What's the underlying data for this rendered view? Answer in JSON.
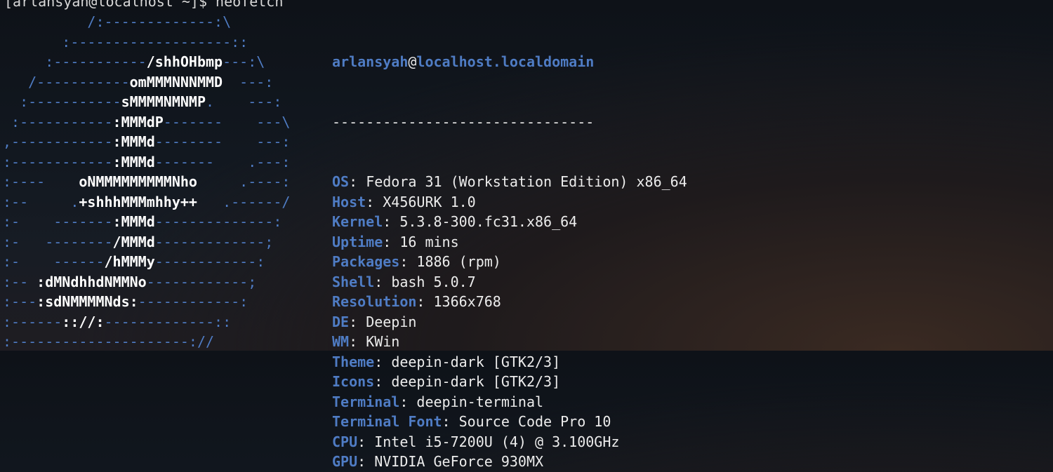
{
  "prompt": "[arlansyah@localhost ~]$ neofetch",
  "art": [
    [
      [
        "b",
        "          /:-------------:\\"
      ]
    ],
    [
      [
        "b",
        "       :-------------------::"
      ]
    ],
    [
      [
        "b",
        "     :-----------"
      ],
      [
        "w",
        "/shhOHbmp"
      ],
      [
        "b",
        "---:\\"
      ]
    ],
    [
      [
        "b",
        "   /-----------"
      ],
      [
        "w",
        "omMMMNNNMMD"
      ],
      [
        "b",
        "  ---:"
      ]
    ],
    [
      [
        "b",
        "  :-----------"
      ],
      [
        "w",
        "sMMMMNMNMP"
      ],
      [
        "b",
        ".    ---:"
      ]
    ],
    [
      [
        "b",
        " :-----------"
      ],
      [
        "w",
        ":MMMdP"
      ],
      [
        "b",
        "-------    ---\\"
      ]
    ],
    [
      [
        "b",
        ",------------"
      ],
      [
        "w",
        ":MMMd"
      ],
      [
        "b",
        "--------    ---:"
      ]
    ],
    [
      [
        "b",
        ":------------"
      ],
      [
        "w",
        ":MMMd"
      ],
      [
        "b",
        "-------    .---:"
      ]
    ],
    [
      [
        "b",
        ":----    "
      ],
      [
        "w",
        "oNMMMMMMMMMNho"
      ],
      [
        "b",
        "     .----:"
      ]
    ],
    [
      [
        "b",
        ":--     ."
      ],
      [
        "w",
        "+shhhMMMmhhy++"
      ],
      [
        "b",
        "   .------/"
      ]
    ],
    [
      [
        "b",
        ":-    -------"
      ],
      [
        "w",
        ":MMMd"
      ],
      [
        "b",
        "--------------:"
      ]
    ],
    [
      [
        "b",
        ":-   --------"
      ],
      [
        "w",
        "/MMMd"
      ],
      [
        "b",
        "-------------;"
      ]
    ],
    [
      [
        "b",
        ":-    ------"
      ],
      [
        "w",
        "/hMMMy"
      ],
      [
        "b",
        "------------:"
      ]
    ],
    [
      [
        "b",
        ":-- "
      ],
      [
        "w",
        ":dMNdhhdNMMNo"
      ],
      [
        "b",
        "------------;"
      ]
    ],
    [
      [
        "b",
        ":---"
      ],
      [
        "w",
        ":sdNMMMMNds:"
      ],
      [
        "b",
        "------------:"
      ]
    ],
    [
      [
        "b",
        ":------"
      ],
      [
        "w",
        ":://:"
      ],
      [
        "b",
        "-------------::"
      ]
    ],
    [
      [
        "b",
        ":---------------------://"
      ]
    ]
  ],
  "header": {
    "user": "arlansyah",
    "at": "@",
    "host": "localhost.localdomain",
    "separator": "-------------------------------"
  },
  "info": [
    {
      "key": "OS",
      "value": "Fedora 31 (Workstation Edition) x86_64"
    },
    {
      "key": "Host",
      "value": "X456URK 1.0"
    },
    {
      "key": "Kernel",
      "value": "5.3.8-300.fc31.x86_64"
    },
    {
      "key": "Uptime",
      "value": "16 mins"
    },
    {
      "key": "Packages",
      "value": "1886 (rpm)"
    },
    {
      "key": "Shell",
      "value": "bash 5.0.7"
    },
    {
      "key": "Resolution",
      "value": "1366x768"
    },
    {
      "key": "DE",
      "value": "Deepin"
    },
    {
      "key": "WM",
      "value": "KWin"
    },
    {
      "key": "Theme",
      "value": "deepin-dark [GTK2/3]"
    },
    {
      "key": "Icons",
      "value": "deepin-dark [GTK2/3]"
    },
    {
      "key": "Terminal",
      "value": "deepin-terminal"
    },
    {
      "key": "Terminal Font",
      "value": "Source Code Pro 10"
    },
    {
      "key": "CPU",
      "value": "Intel i5-7200U (4) @ 3.100GHz"
    },
    {
      "key": "GPU",
      "value": "NVIDIA GeForce 930MX"
    }
  ],
  "colors": {
    "accent_blue": "#4f7cc4",
    "text": "#ececec",
    "background": "#121820"
  }
}
